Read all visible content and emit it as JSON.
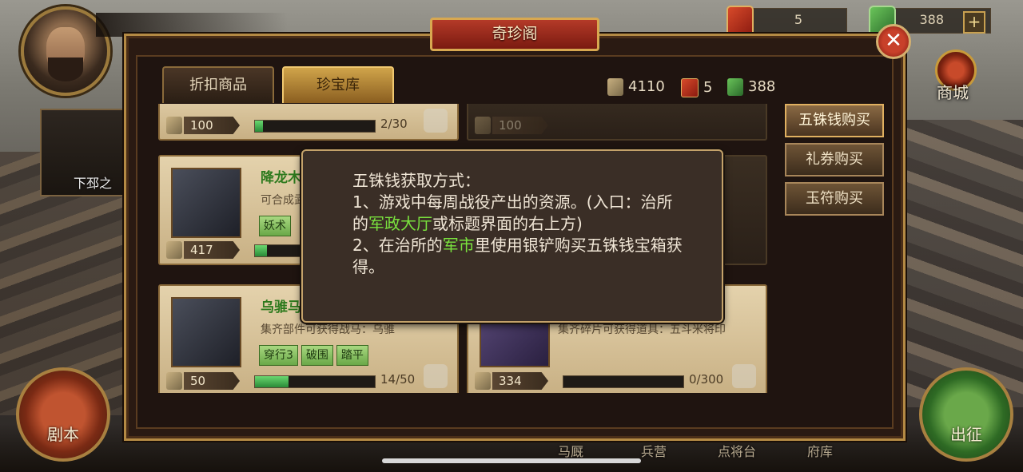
{
  "hud": {
    "token_count": "5",
    "jade_count": "388",
    "plus_label": "+",
    "mall_label": "商城",
    "left_card_label": "下邳之",
    "script_label": "剧本",
    "go_label": "出征",
    "bottom_nav": [
      "马厩",
      "兵营",
      "点将台",
      "府库"
    ]
  },
  "panel": {
    "title": "奇珍阁",
    "close_label": "✕",
    "tabs": [
      "折扣商品",
      "珍宝库"
    ],
    "active_tab": 1,
    "currencies": {
      "wuzhu": "4110",
      "token": "5",
      "jade": "388"
    },
    "side_buttons": [
      "五铢钱购买",
      "礼券购买",
      "玉符购买"
    ],
    "active_side": 0
  },
  "items": [
    {
      "name": "",
      "price": "100",
      "progress": "2/30",
      "fraction": 0.067,
      "dim": false
    },
    {
      "name": "",
      "price": "100",
      "dim": true
    },
    {
      "name": "降龙木法",
      "desc": "可合成武",
      "tags": [
        "妖术"
      ],
      "price": "417",
      "fraction": 0.1,
      "dim": false
    },
    {
      "name": "",
      "dim": true
    },
    {
      "name": "乌骓马鞍",
      "desc": "集齐部件可获得战马：乌骓",
      "tags": [
        "穿行3",
        "破围",
        "踏平"
      ],
      "price": "50",
      "progress": "14/50",
      "fraction": 0.28,
      "dim": false
    },
    {
      "name": "",
      "desc": "集齐碎片可获得道具：五斗米将印",
      "price": "334",
      "progress": "0/300",
      "fraction": 0,
      "dim": false
    }
  ],
  "tooltip": {
    "line1": "五铢钱获取方式：",
    "line2_a": "1、游戏中每周战役产出的资源。(入口：治所的",
    "line2_hl": "军政大厅",
    "line2_b": "或标题界面的右上方)",
    "line3_a": "2、在治所的",
    "line3_hl": "军市",
    "line3_b": "里使用银铲购买五铢钱宝箱获得。"
  },
  "colors": {
    "highlight_green": "#7ae23e",
    "tab_active": "#d0a44a",
    "progress_fill": "#2a8a38"
  }
}
